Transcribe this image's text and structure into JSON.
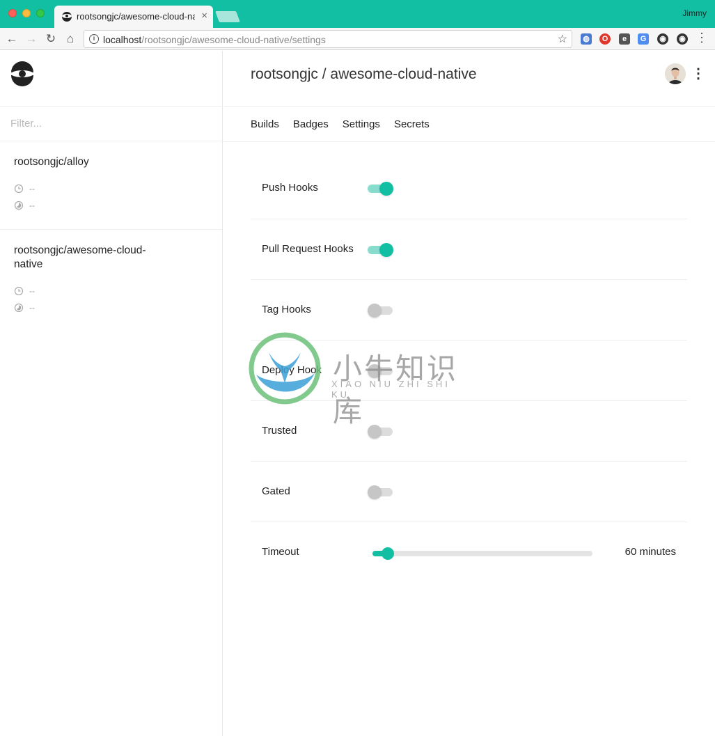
{
  "browser": {
    "tab_title": "rootsongjc/awesome-cloud-native/settings",
    "profile_name": "Jimmy",
    "url_host": "localhost",
    "url_path": "/rootsongjc/awesome-cloud-native/settings",
    "accent": "#12bfa3"
  },
  "sidebar": {
    "filter_placeholder": "Filter...",
    "repos": [
      {
        "name": "rootsongjc/alloy",
        "last_build": "--",
        "duration": "--"
      },
      {
        "name": "rootsongjc/awesome-cloud-native",
        "last_build": "--",
        "duration": "--"
      }
    ]
  },
  "header": {
    "title": "rootsongjc / awesome-cloud-native"
  },
  "tabs": [
    "Builds",
    "Badges",
    "Settings",
    "Secrets"
  ],
  "settings": {
    "push_hooks": {
      "label": "Push Hooks",
      "enabled": true
    },
    "pull_request_hooks": {
      "label": "Pull Request Hooks",
      "enabled": true
    },
    "tag_hooks": {
      "label": "Tag Hooks",
      "enabled": false
    },
    "deploy_hook": {
      "label": "Deploy Hook",
      "enabled": false
    },
    "trusted": {
      "label": "Trusted",
      "enabled": false
    },
    "gated": {
      "label": "Gated",
      "enabled": false
    },
    "timeout": {
      "label": "Timeout",
      "value_text": "60 minutes",
      "fraction": 0.07
    }
  },
  "watermark": {
    "cn": "小牛知识库",
    "en": "XIAO NIU ZHI SHI KU"
  }
}
